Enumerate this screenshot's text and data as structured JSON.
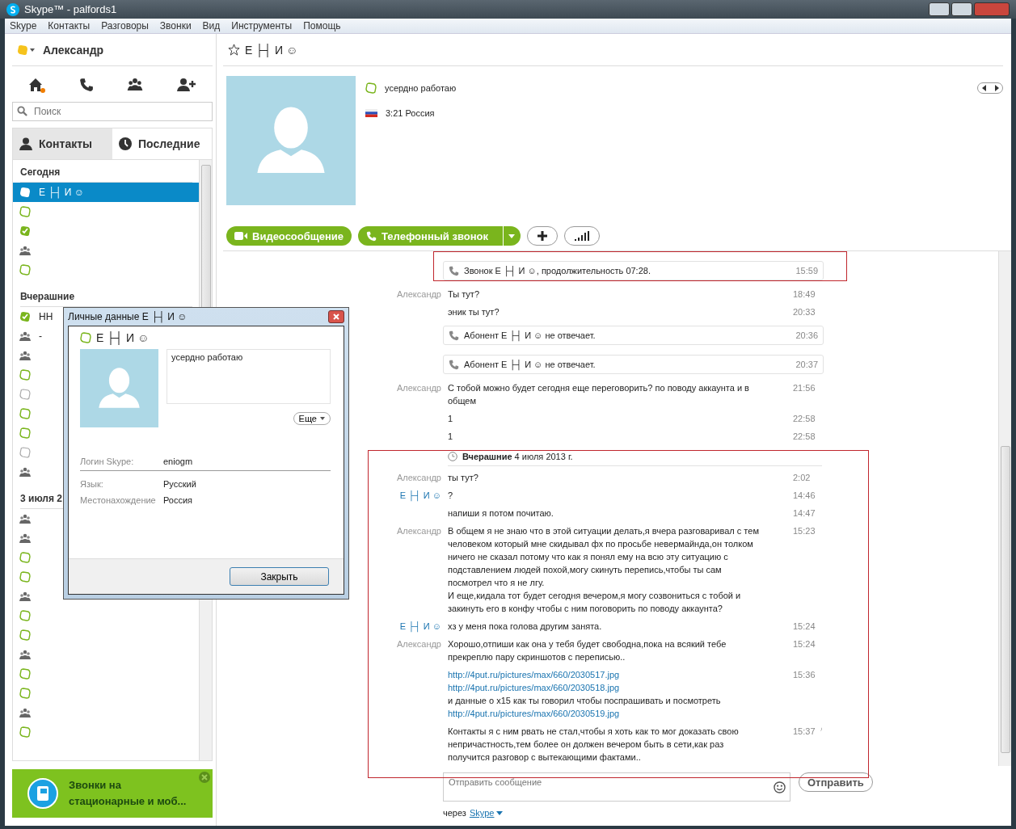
{
  "window": {
    "title": "Skype™ - palfords1"
  },
  "menu": [
    "Skype",
    "Контакты",
    "Разговоры",
    "Звонки",
    "Вид",
    "Инструменты",
    "Помощь"
  ],
  "profile": {
    "name": "Александр"
  },
  "search": {
    "placeholder": "Поиск"
  },
  "tabs": [
    {
      "label": "Контакты",
      "selected": false
    },
    {
      "label": "Последние",
      "selected": true
    }
  ],
  "recent_groups": [
    {
      "title": "Сегодня",
      "items": [
        {
          "kind": "online",
          "name": "Ε ├┤ И ☺",
          "selected": true
        },
        {
          "kind": "away",
          "selected": false
        },
        {
          "kind": "checked",
          "selected": false
        },
        {
          "kind": "group",
          "selected": false
        },
        {
          "kind": "away",
          "selected": false
        }
      ]
    },
    {
      "title": "Вчерашние",
      "items": [
        {
          "kind": "checked",
          "name": "НН",
          "selected": false
        },
        {
          "kind": "group",
          "name": "-",
          "selected": false
        },
        {
          "kind": "group",
          "selected": false
        },
        {
          "kind": "away",
          "selected": false
        },
        {
          "kind": "unknown",
          "selected": false
        },
        {
          "kind": "away",
          "selected": false
        },
        {
          "kind": "away",
          "selected": false
        },
        {
          "kind": "unknown",
          "selected": false
        },
        {
          "kind": "group",
          "selected": false
        }
      ]
    },
    {
      "title": "3 июля 2",
      "items": [
        {
          "kind": "group",
          "selected": false
        },
        {
          "kind": "group",
          "selected": false
        },
        {
          "kind": "away",
          "selected": false
        },
        {
          "kind": "away",
          "selected": false
        },
        {
          "kind": "group",
          "selected": false
        },
        {
          "kind": "away",
          "selected": false
        },
        {
          "kind": "away",
          "selected": false
        },
        {
          "kind": "group",
          "selected": false
        },
        {
          "kind": "away",
          "selected": false
        },
        {
          "kind": "away",
          "selected": false
        },
        {
          "kind": "group",
          "selected": false
        },
        {
          "kind": "away",
          "selected": false
        }
      ]
    }
  ],
  "promo": {
    "text": "Звонки на стационарные и моб..."
  },
  "contact": {
    "name": "Ε ├┤ И ☺",
    "mood": "усердно работаю",
    "local_time": "3:21 Россия"
  },
  "actions": {
    "video": "Видеосообщение",
    "call": "Телефонный звонок"
  },
  "messages": [
    {
      "kind": "call",
      "text": "Звонок Ε ├┤ И ☺, продолжительность 07:28.",
      "time": "15:59"
    },
    {
      "kind": "message",
      "sender": "Александр",
      "color": "#999999",
      "lines": [
        {
          "kind": "text",
          "text": "Ты тут?"
        }
      ],
      "time": "18:49"
    },
    {
      "kind": "message",
      "lines": [
        {
          "kind": "text",
          "text": "эник ты тут?"
        }
      ],
      "time": "20:33"
    },
    {
      "kind": "call",
      "text": "Абонент Ε ├┤ И ☺ не отвечает.",
      "time": "20:36"
    },
    {
      "kind": "call",
      "text": "Абонент Ε ├┤ И ☺ не отвечает.",
      "time": "20:37"
    },
    {
      "kind": "message",
      "sender": "Александр",
      "color": "#999999",
      "lines": [
        {
          "kind": "text",
          "text": "С тобой можно будет сегодня еще переговорить? по поводу аккаунта и в общем"
        }
      ],
      "time": "21:56"
    },
    {
      "kind": "message",
      "lines": [
        {
          "kind": "text",
          "text": "1"
        }
      ],
      "time": "22:58"
    },
    {
      "kind": "message",
      "lines": [
        {
          "kind": "text",
          "text": "1"
        }
      ],
      "time": "22:58"
    },
    {
      "kind": "date",
      "text": "**Вчерашние** 4 июля 2013 г."
    },
    {
      "kind": "message",
      "sender": "Александр",
      "color": "#999999",
      "lines": [
        {
          "kind": "text",
          "text": "ты тут?"
        }
      ],
      "time": "2:02"
    },
    {
      "kind": "message",
      "sender": "Ε ├┤ И ☺",
      "color": "#1a74b0",
      "lines": [
        {
          "kind": "text",
          "text": "?"
        }
      ],
      "time": "14:46"
    },
    {
      "kind": "message",
      "lines": [
        {
          "kind": "text",
          "text": "напиши я потом почитаю."
        }
      ],
      "time": "14:47"
    },
    {
      "kind": "message",
      "sender": "Александр",
      "color": "#999999",
      "lines": [
        {
          "kind": "text",
          "text": "В общем я не знаю что в этой ситуации делать,я вчера разговаривал с тем человеком который мне скидывал фх по просьбе невермайнда,он толком ничего не сказал потому что как я понял ему на всю эту ситуацию с подставлением людей похой,могу скинуть перепись,чтобы ты сам посмотрел что я не лгу."
        },
        {
          "kind": "text",
          "text": "И еще,кидала тот будет сегодня вечером,я могу созвониться с тобой и закинуть его в конфу чтобы с ним поговорить по поводу аккаунта?"
        }
      ],
      "time": "15:23"
    },
    {
      "kind": "message",
      "sender": "Ε ├┤ И ☺",
      "color": "#1a74b0",
      "lines": [
        {
          "kind": "text",
          "text": "хз у меня пока голова другим занята."
        }
      ],
      "time": "15:24"
    },
    {
      "kind": "message",
      "sender": "Александр",
      "color": "#999999",
      "lines": [
        {
          "kind": "text",
          "text": "Хорошо,отпиши как она у тебя будет свободна,пока на всякий тебе прекреплю пару скриншотов с переписью.."
        }
      ],
      "time": "15:24"
    },
    {
      "kind": "message",
      "lines": [
        {
          "kind": "link",
          "text": "http://4put.ru/pictures/max/660/2030517.jpg"
        },
        {
          "kind": "link",
          "text": "http://4put.ru/pictures/max/660/2030518.jpg"
        },
        {
          "kind": "text",
          "text": "и данные о х15 как ты говорил чтобы поспрашивать и посмотреть"
        },
        {
          "kind": "link",
          "text": "http://4put.ru/pictures/max/660/2030519.jpg"
        }
      ],
      "time": "15:36"
    },
    {
      "kind": "message",
      "edited": true,
      "lines": [
        {
          "kind": "text",
          "text": "Контакты я с ним рвать не стал,чтобы я хоть как то мог доказать свою непричастность,тем более он должен вечером быть в сети,как раз получится разговор с вытекающими фактами.."
        }
      ],
      "time": "15:37"
    }
  ],
  "compose": {
    "placeholder": "Отправить сообщение",
    "send": "Отправить",
    "via": "через",
    "via_service": "Skype"
  },
  "dialog": {
    "title": "Личные данные Ε ├┤ И ☺",
    "name": "Ε ├┤ И ☺",
    "mood": "усердно работаю",
    "more": "Еще",
    "fields": [
      {
        "label": "Логин Skype:",
        "value": "eniogm"
      },
      {
        "label": "Язык:",
        "value": "Русский"
      },
      {
        "label": "Местонахождение",
        "value": "Россия"
      }
    ],
    "close": "Закрыть"
  }
}
